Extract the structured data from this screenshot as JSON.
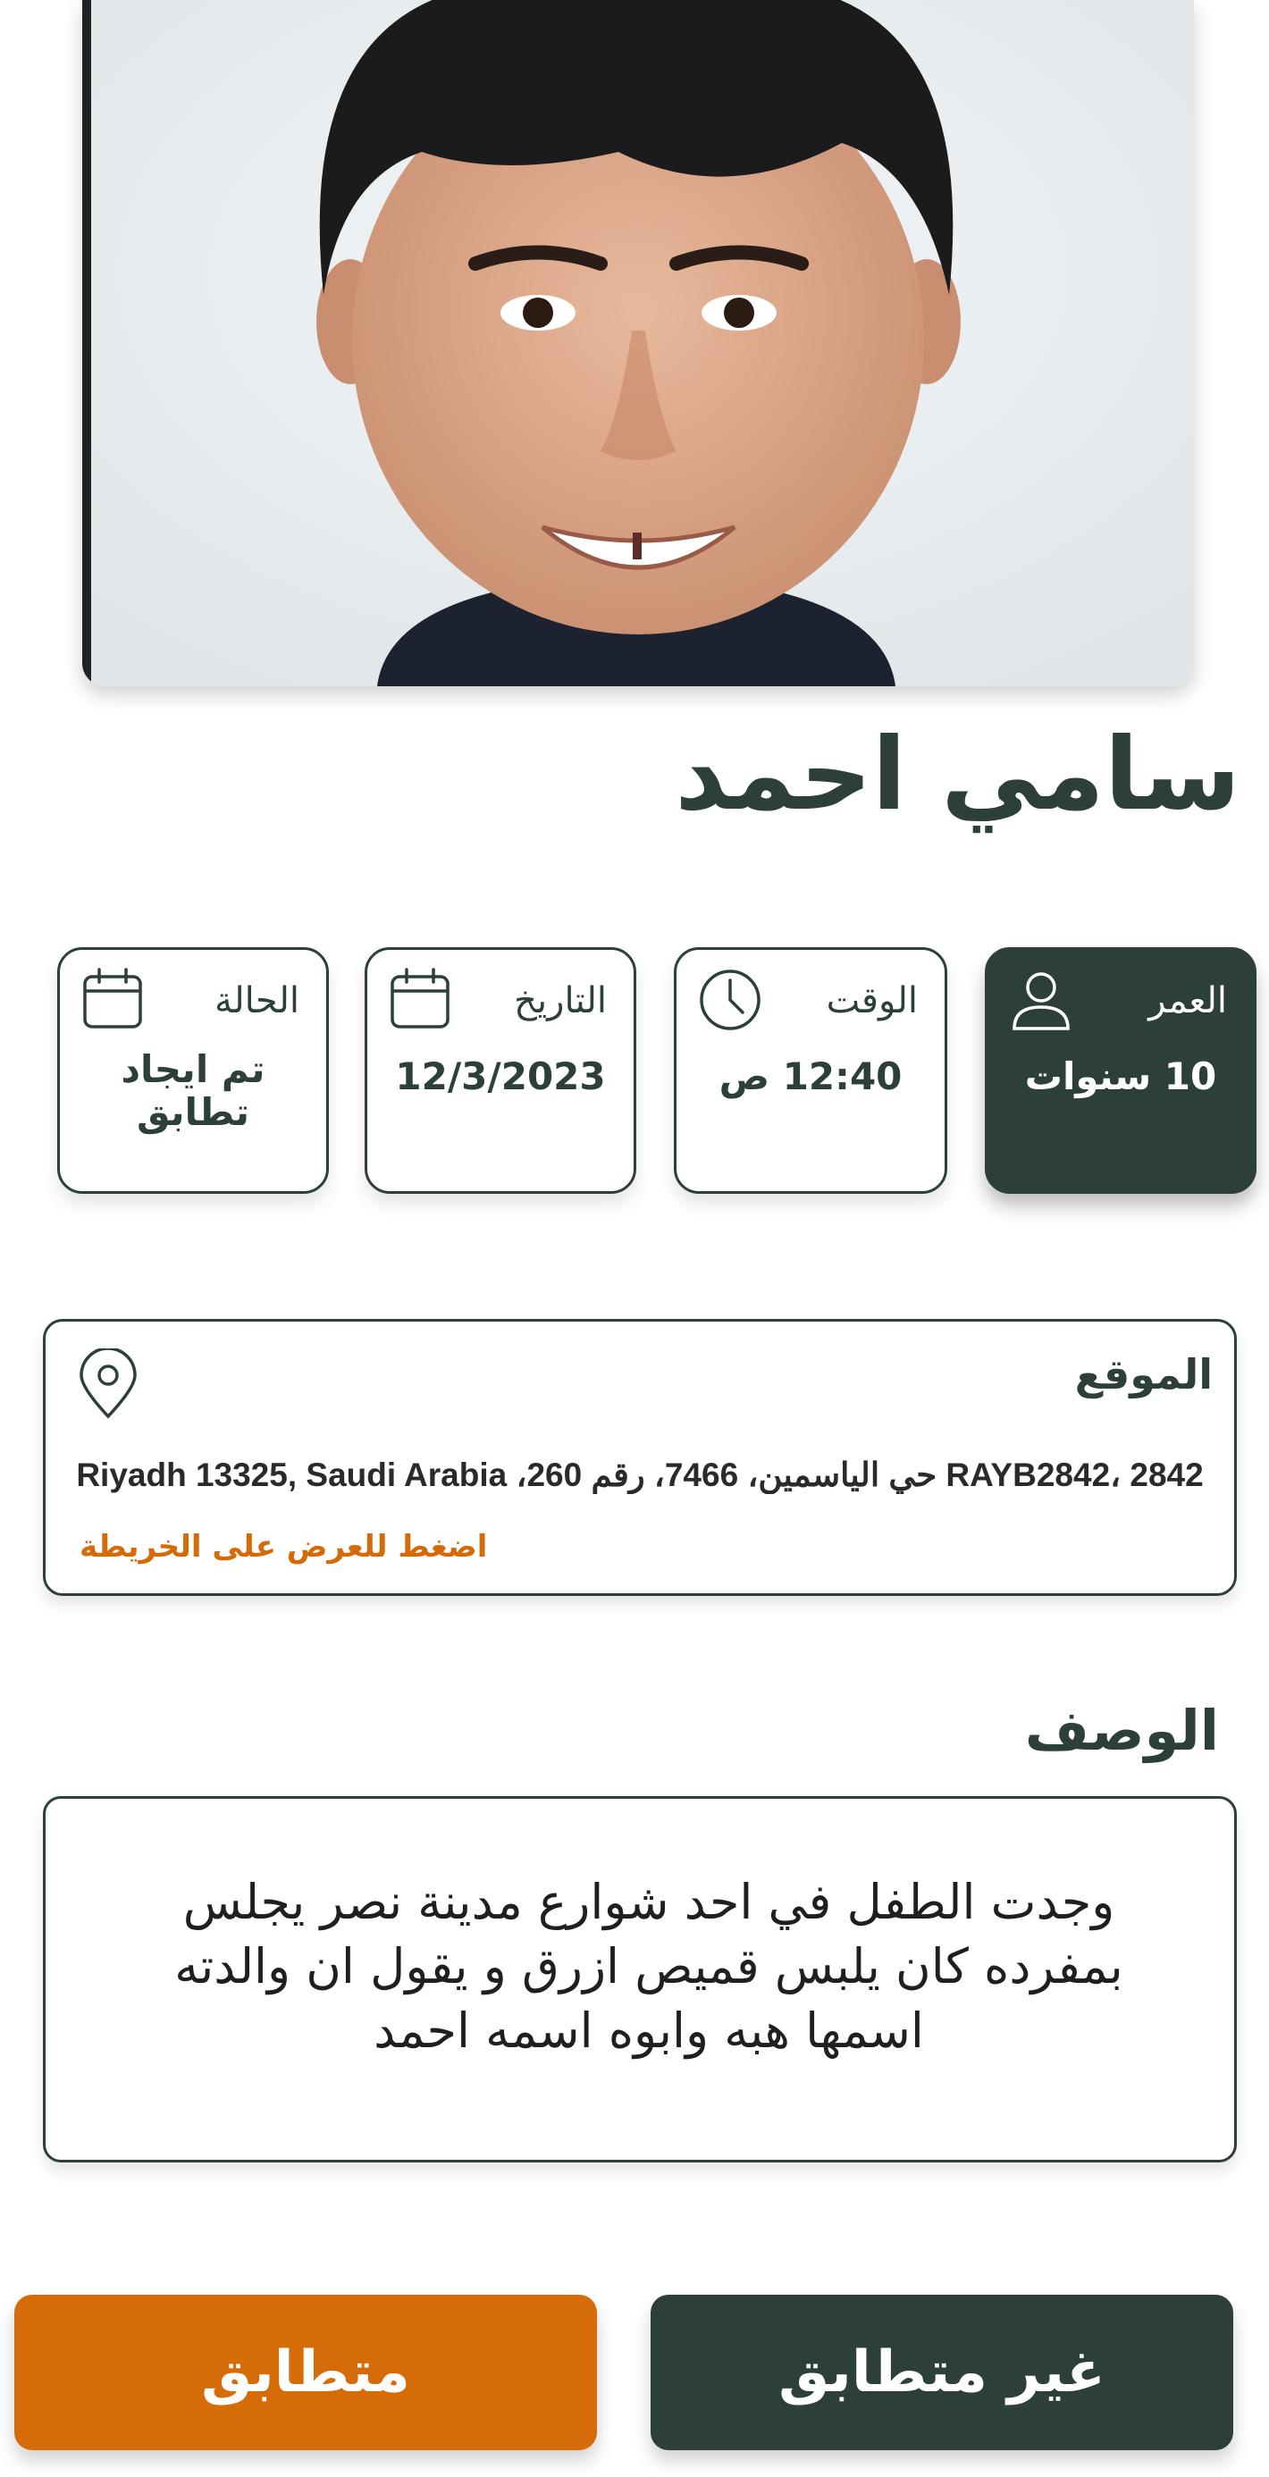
{
  "child": {
    "name": "سامي احمد"
  },
  "info_cards": {
    "age": {
      "label": "العمر",
      "value": "10 سنوات",
      "icon": "user-icon"
    },
    "time": {
      "label": "الوقت",
      "value": "12:40 ص",
      "icon": "clock-icon"
    },
    "date": {
      "label": "التاريخ",
      "value": "12/3/2023",
      "icon": "calendar-icon"
    },
    "status": {
      "label": "الحالة",
      "value": "تم ايجاد تطابق",
      "icon": "calendar-icon"
    }
  },
  "location": {
    "title": "الموقع",
    "address": "RAYB2842، 2842 حي الياسمين، 7466، رقم 260، Riyadh 13325, Saudi Arabia",
    "map_link": "اضغط للعرض على الخريطة",
    "icon": "map-pin-icon"
  },
  "description": {
    "heading": "الوصف",
    "text": "وجدت الطفل في احد شوارع مدينة نصر يجلس بمفرده كان يلبس قميص ازرق و يقول ان والدته اسمها هبه وابوه اسمه احمد"
  },
  "actions": {
    "not_match_label": "غير متطابق",
    "match_label": "متطابق"
  },
  "colors": {
    "primary": "#2d4038",
    "accent": "#d56c08",
    "background": "#ffffff"
  }
}
